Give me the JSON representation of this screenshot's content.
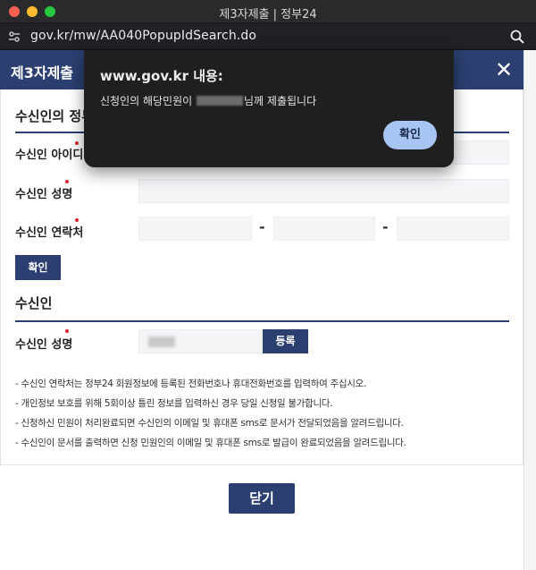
{
  "window": {
    "title": "제3자제출 | 정부24"
  },
  "browser": {
    "url": "gov.kr/mw/AA040PopupIdSearch.do"
  },
  "page": {
    "title": "제3자제출",
    "close_symbol": "✕",
    "section1_title": "수신인의 정부24",
    "fields": {
      "id_label": "수신인 아이디",
      "name_label": "수신인 성명",
      "phone_label": "수신인 연락처",
      "dash": "-"
    },
    "confirm_label": "확인",
    "section2_title": "수신인",
    "recipient_name_label": "수신인 성명",
    "register_label": "등록",
    "notes": [
      "- 수신인 연락처는 정부24 회원정보에 등록된 전화번호나 휴대전화번호를 입력하여 주십시오.",
      "- 개인정보 보호를 위해 5회이상 틀린 정보를 입력하신 경우 당일 신청일 불가합니다.",
      "- 신청하신 민원이 처리완료되면 수신인의 이메일 및 휴대폰 sms로 문서가 전달되었음을 알려드립니다.",
      "- 수신인이 문서를 출력하면 신청 민원인의 이메일 및 휴대폰 sms로 발급이 완료되었음을 알려드립니다."
    ],
    "bottom_close_label": "닫기"
  },
  "dialog": {
    "title": "www.gov.kr 내용:",
    "message_prefix": "신청인의 해당민원이",
    "message_suffix": "님께 제출됩니다",
    "ok_label": "확인"
  },
  "colors": {
    "header_navy": "#2b4071",
    "required_dot": "#d9242a",
    "dialog_bg": "#1f1f1f",
    "dialog_button": "#a8c4f2"
  }
}
